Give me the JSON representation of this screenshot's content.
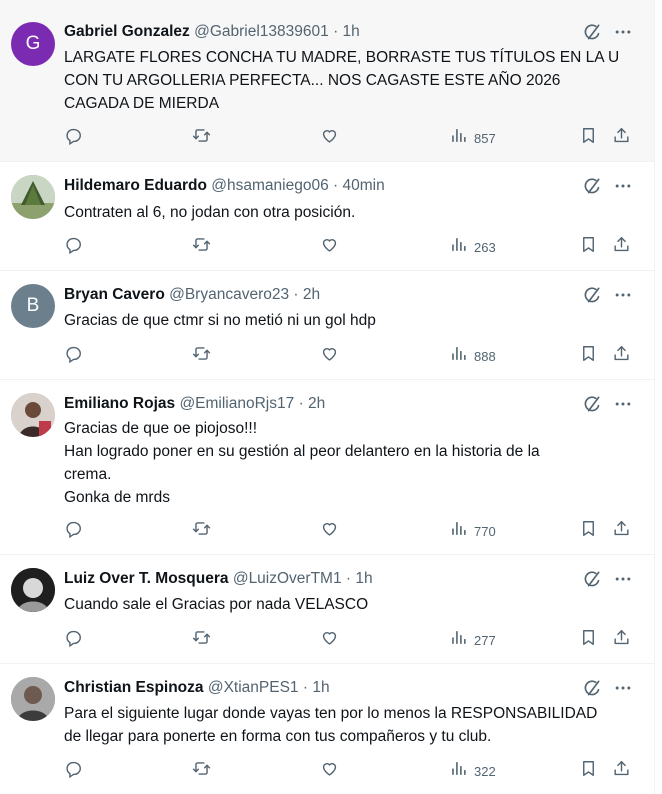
{
  "tweets": [
    {
      "name": "Gabriel Gonzalez",
      "handle": "@Gabriel13839601",
      "time": "1h",
      "avatar_letter": "G",
      "avatar_color": "#7b2bb2",
      "lines": [
        "LARGATE FLORES CONCHA TU MADRE, BORRASTE TUS TÍTULOS EN LA U",
        "CON TU ARGOLLERIA PERFECTA... NOS CAGASTE ESTE AÑO 2026",
        "CAGADA DE MIERDA"
      ],
      "views": "857"
    },
    {
      "name": "Hildemaro Eduardo",
      "handle": "@hsamaniego06",
      "time": "40min",
      "lines": [
        "Contraten al 6, no jodan con otra posición."
      ],
      "views": "263"
    },
    {
      "name": "Bryan Cavero",
      "handle": "@Bryancavero23",
      "time": "2h",
      "avatar_letter": "B",
      "avatar_color": "#6b7f8c",
      "lines": [
        "Gracias de que ctmr si no metió ni un gol hdp"
      ],
      "views": "888"
    },
    {
      "name": "Emiliano Rojas",
      "handle": "@EmilianoRjs17",
      "time": "2h",
      "lines": [
        "Gracias de que oe piojoso!!!",
        "Han logrado poner en su gestión al peor delantero en la historia de la",
        "crema.",
        "Gonka de mrds"
      ],
      "views": "770"
    },
    {
      "name": "Luiz Over T. Mosquera",
      "handle": "@LuizOverTM1",
      "time": "1h",
      "lines": [
        "Cuando sale el Gracias por nada VELASCO"
      ],
      "views": "277"
    },
    {
      "name": "Christian Espinoza",
      "handle": "@XtianPES1",
      "time": "1h",
      "lines": [
        "Para el siguiente lugar donde vayas ten por lo menos la RESPONSABILIDAD",
        "de llegar para ponerte en forma con tus compañeros y tu club."
      ],
      "views": "322"
    }
  ],
  "separator": "·",
  "icons": {
    "reply": "reply-icon",
    "retweet": "retweet-icon",
    "like": "like-icon",
    "views": "views-icon",
    "bookmark": "bookmark-icon",
    "share": "share-icon",
    "grok": "grok-icon",
    "more": "more-icon"
  }
}
